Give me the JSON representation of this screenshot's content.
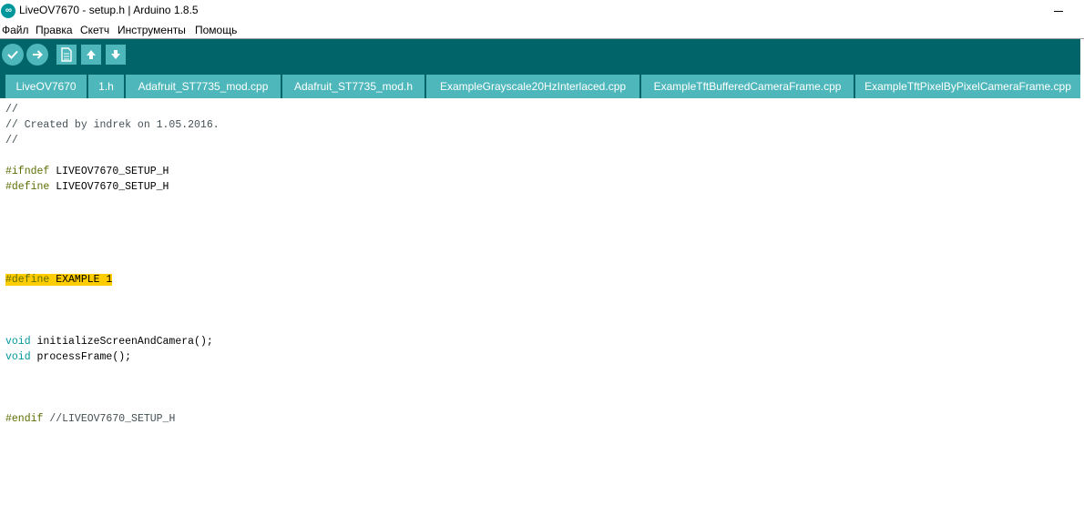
{
  "window": {
    "title": "LiveOV7670 - setup.h | Arduino 1.8.5"
  },
  "menu": [
    "Файл",
    "Правка",
    "Скетч",
    "Инструменты",
    "Помощь"
  ],
  "toolbar": {
    "verify": "verify-icon",
    "upload": "upload-icon",
    "new": "new-sketch-icon",
    "open": "open-icon",
    "save": "save-icon"
  },
  "tabs": [
    {
      "label": "LiveOV7670",
      "active": true
    },
    {
      "label": "1.h",
      "active": false
    },
    {
      "label": "Adafruit_ST7735_mod.cpp",
      "active": false
    },
    {
      "label": "Adafruit_ST7735_mod.h",
      "active": false
    },
    {
      "label": "ExampleGrayscale20HzInterlaced.cpp",
      "active": false
    },
    {
      "label": "ExampleTftBufferedCameraFrame.cpp",
      "active": false
    },
    {
      "label": "ExampleTftPixelByPixelCameraFrame.cpp",
      "active": false
    }
  ],
  "code": {
    "line1": "//",
    "line2": "// Created by indrek on 1.05.2016.",
    "line3": "//",
    "ifndef_kw": "#ifndef",
    "ifndef_rest": " LIVEOV7670_SETUP_H",
    "define1_kw": "#define",
    "define1_rest": " LIVEOV7670_SETUP_H",
    "define2_kw": "#define",
    "define2_rest": " EXAMPLE 1",
    "void1_kw": "void",
    "void1_rest": " initializeScreenAndCamera();",
    "void2_kw": "void",
    "void2_rest": " processFrame();",
    "endif_kw": "#endif",
    "endif_comment": " //LIVEOV7670_SETUP_H"
  },
  "colors": {
    "toolbar": "#006468",
    "tab": "#4db7bb",
    "active_tab": "#e5eef0",
    "highlight": "#ffcc00"
  }
}
